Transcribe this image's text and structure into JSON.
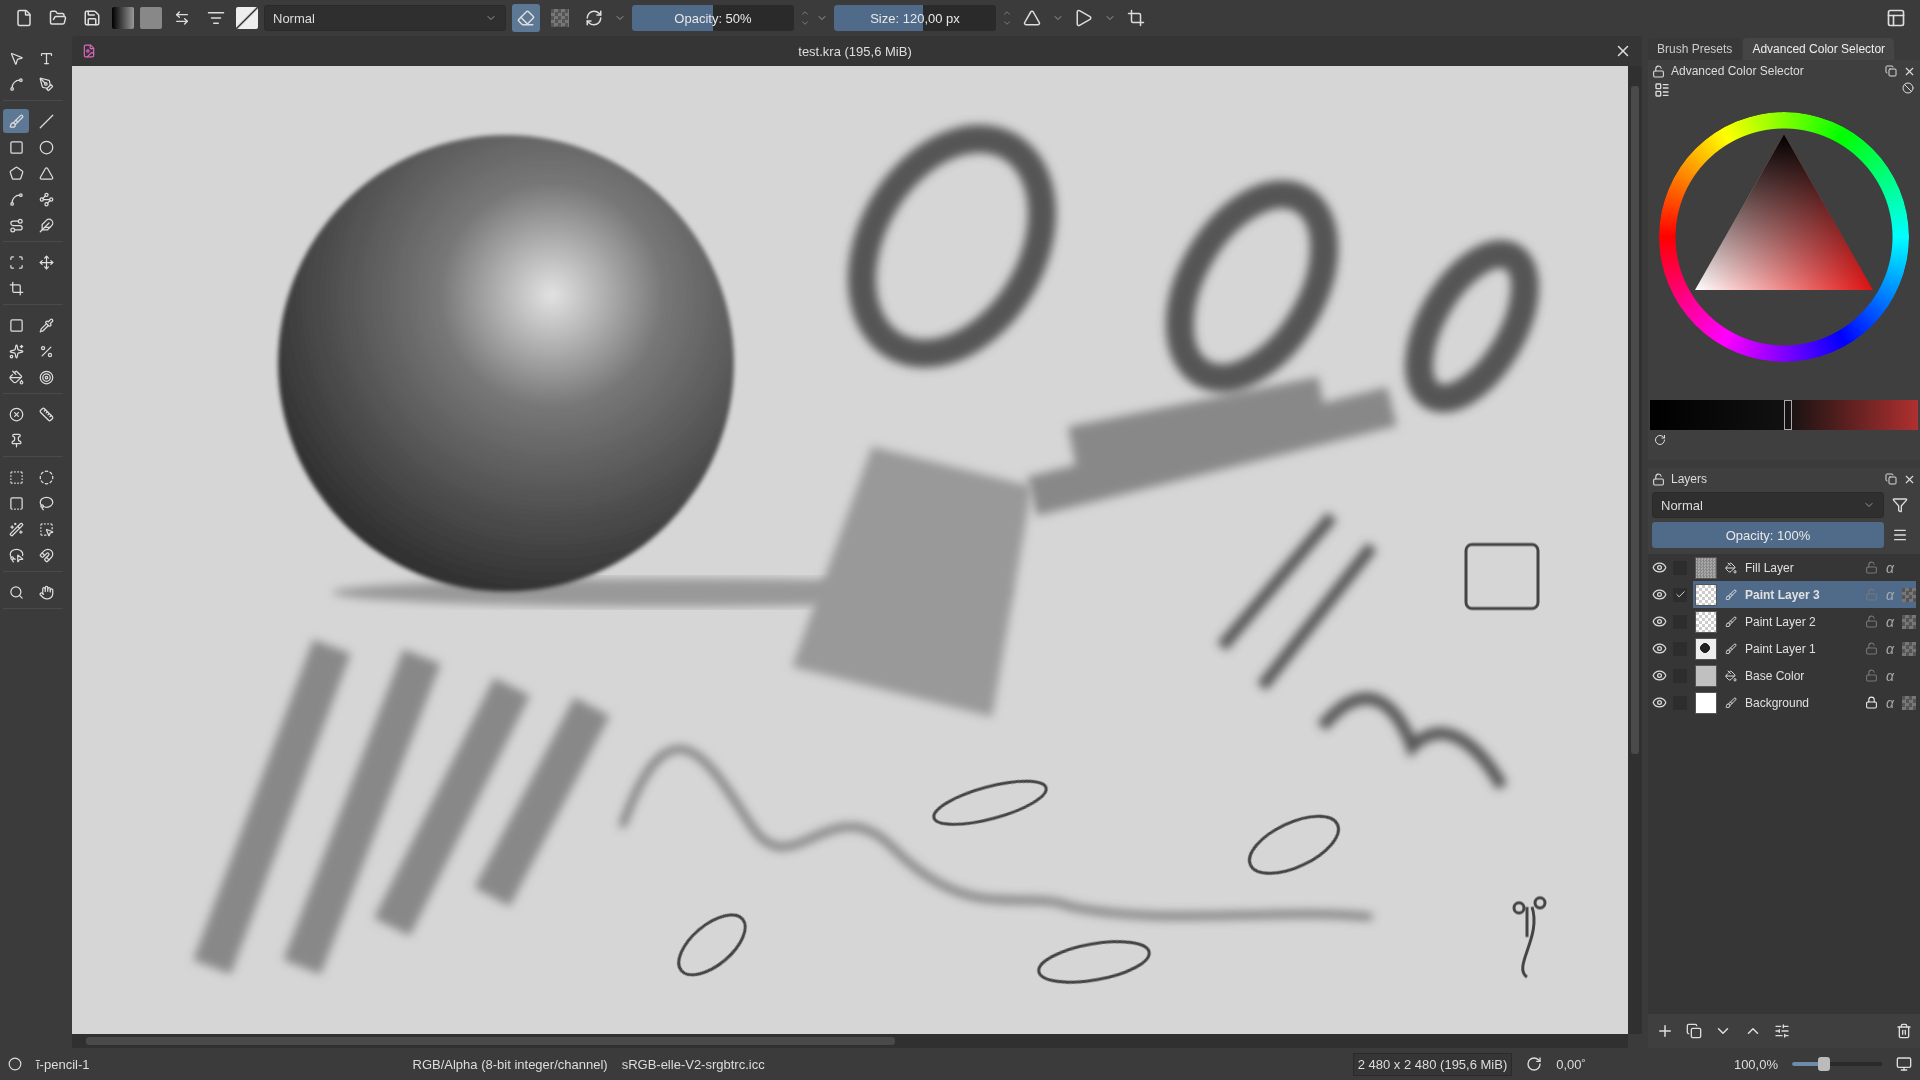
{
  "toolbar": {
    "blend_mode": "Normal",
    "eraser_on": true,
    "opacity": {
      "label": "Opacity: 50%",
      "level": 0.5
    },
    "size": {
      "label": "Size: 120,00 px",
      "level": 0.55
    }
  },
  "tool_groups": [
    [
      {
        "kind": "select",
        "selected": false
      },
      {
        "kind": "text",
        "selected": false
      },
      {
        "kind": "edit-shapes",
        "selected": false
      },
      {
        "kind": "calligraphy",
        "selected": false
      }
    ],
    [
      {
        "kind": "brush",
        "selected": true
      },
      {
        "kind": "line",
        "selected": false
      },
      {
        "kind": "rectangle",
        "selected": false
      },
      {
        "kind": "ellipse",
        "selected": false
      },
      {
        "kind": "polygon",
        "selected": false
      },
      {
        "kind": "polyline",
        "selected": false
      },
      {
        "kind": "bezier",
        "selected": false
      },
      {
        "kind": "path",
        "selected": false
      },
      {
        "kind": "freehand",
        "selected": false
      },
      {
        "kind": "dynamic",
        "selected": false
      }
    ],
    [
      {
        "kind": "transform",
        "selected": false
      },
      {
        "kind": "move",
        "selected": false
      },
      {
        "kind": "crop",
        "selected": false
      }
    ],
    [
      {
        "kind": "gradient",
        "selected": false
      },
      {
        "kind": "picker",
        "selected": false
      },
      {
        "kind": "patch",
        "selected": false
      },
      {
        "kind": "percent",
        "selected": false
      },
      {
        "kind": "fill",
        "selected": false
      },
      {
        "kind": "enclose",
        "selected": false
      }
    ],
    [
      {
        "kind": "assistant",
        "selected": false
      },
      {
        "kind": "measure",
        "selected": false
      },
      {
        "kind": "pin",
        "selected": false
      }
    ],
    [
      {
        "kind": "rect-select",
        "selected": false
      },
      {
        "kind": "ellipse-select",
        "selected": false
      },
      {
        "kind": "poly-select",
        "selected": false
      },
      {
        "kind": "lasso",
        "selected": false
      },
      {
        "kind": "wand",
        "selected": false
      },
      {
        "kind": "color-select",
        "selected": false
      },
      {
        "kind": "bezier-select",
        "selected": false
      },
      {
        "kind": "magnetic-select",
        "selected": false
      }
    ],
    [
      {
        "kind": "zoom",
        "selected": false
      },
      {
        "kind": "pan",
        "selected": false
      }
    ]
  ],
  "document": {
    "title": "test.kra (195,6 MiB)"
  },
  "dock_tabs": [
    {
      "label": "Brush Presets",
      "selected": false
    },
    {
      "label": "Advanced Color Selector",
      "selected": true
    }
  ],
  "color_selector": {
    "title": "Advanced Color Selector"
  },
  "layers_panel": {
    "title": "Layers",
    "blend_mode": "Normal",
    "opacity": {
      "label": "Opacity:  100%",
      "level": 1
    },
    "layers": [
      {
        "name": "Fill Layer",
        "kind": "fill",
        "thumbnail": {
          "kind": "noise"
        },
        "alpha": "α",
        "visible": true,
        "checked": false,
        "selected": false,
        "locked": false
      },
      {
        "name": "Paint Layer 3",
        "kind": "paint",
        "thumbnail": {
          "kind": "sketch"
        },
        "alpha": "α",
        "visible": true,
        "checked": true,
        "selected": true,
        "locked": false
      },
      {
        "name": "Paint Layer 2",
        "kind": "paint",
        "thumbnail": {
          "kind": "sketch"
        },
        "alpha": "α",
        "visible": true,
        "checked": false,
        "selected": false,
        "locked": false
      },
      {
        "name": "Paint Layer 1",
        "kind": "paint",
        "thumbnail": {
          "kind": "sphere"
        },
        "alpha": "α",
        "visible": true,
        "checked": false,
        "selected": false,
        "locked": false
      },
      {
        "name": "Base Color",
        "kind": "fill",
        "thumbnail": {
          "kind": "grey"
        },
        "alpha": "α",
        "visible": true,
        "checked": false,
        "selected": false,
        "locked": false
      },
      {
        "name": "Background",
        "kind": "paint",
        "thumbnail": {
          "kind": "white"
        },
        "alpha": "α",
        "visible": true,
        "checked": false,
        "selected": false,
        "locked": true
      }
    ]
  },
  "status_bar": {
    "brush": "ĩ-pencil-1",
    "color_model": "RGB/Alpha (8-bit integer/channel)",
    "profile": "sRGB-elle-V2-srgbtrc.icc",
    "image_size": "2 480 x 2 480 (195,6 MiB)",
    "rotation": "0,00˚",
    "zoom": "100,0%",
    "zoom_slider": {
      "level": 0.35
    }
  }
}
